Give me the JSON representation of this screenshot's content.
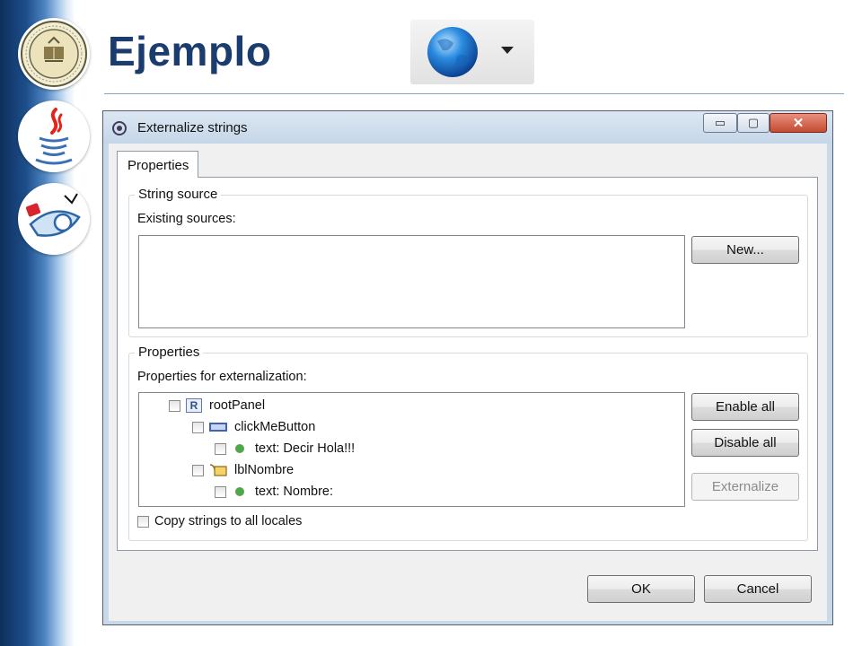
{
  "slide": {
    "title": "Ejemplo",
    "logos": [
      "university-seal-icon",
      "java-cup-icon",
      "netbeans-plane-icon"
    ],
    "toolbar_icon": "globe-icon"
  },
  "dialog": {
    "title": "Externalize strings",
    "window_buttons": {
      "minimize": "▭",
      "maximize": "▢",
      "close": "✕"
    },
    "tab_label": "Properties",
    "string_source": {
      "legend": "String source",
      "existing_label": "Existing sources:",
      "new_button": "New..."
    },
    "properties": {
      "legend": "Properties",
      "for_label": "Properties for externalization:",
      "tree": [
        {
          "label": "rootPanel",
          "icon": "root-panel-icon",
          "level": 0
        },
        {
          "label": "clickMeButton",
          "icon": "button-component-icon",
          "level": 1
        },
        {
          "label": "text: Decir Hola!!!",
          "icon": "property-dot-icon",
          "level": 2
        },
        {
          "label": "lblNombre",
          "icon": "label-component-icon",
          "level": 1
        },
        {
          "label": "text: Nombre:",
          "icon": "property-dot-icon",
          "level": 2
        }
      ],
      "enable_all": "Enable all",
      "disable_all": "Disable all",
      "externalize": "Externalize",
      "copy_strings": "Copy strings to all locales"
    },
    "ok": "OK",
    "cancel": "Cancel"
  },
  "colors": {
    "title_text": "#1b3c6e",
    "sidebar_dark": "#0e2f5c",
    "window_frame": "#c9d9ea",
    "close_button": "#c44a31",
    "property_dot": "#52a64a"
  }
}
